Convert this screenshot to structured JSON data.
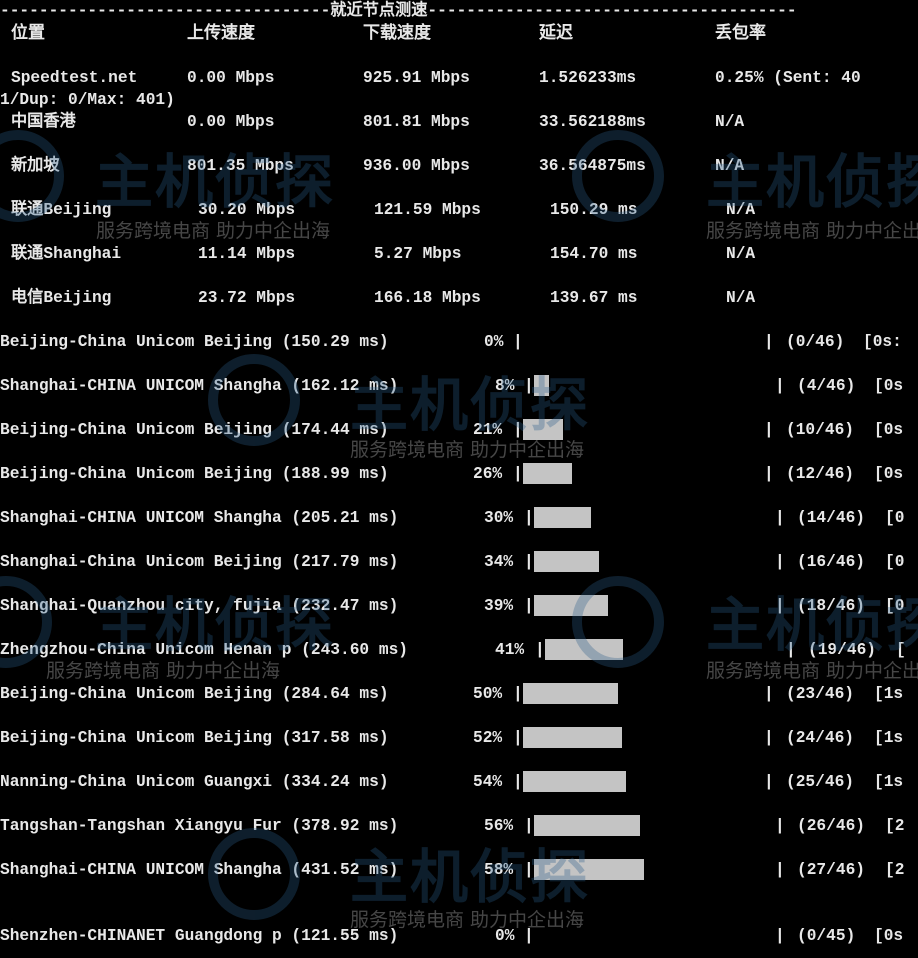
{
  "header": {
    "title": "就近节点测速",
    "dashes_left": "-------------------------------",
    "dashes_right": "-------------------------------"
  },
  "columns": {
    "node": "位置",
    "upload": "上传速度",
    "download": "下载速度",
    "latency": "延迟",
    "loss": "丢包率"
  },
  "speedtest_rows": [
    {
      "node": "Speedtest.net",
      "upload": "0.00 Mbps",
      "download": "925.91 Mbps",
      "latency": "1.526233ms",
      "loss": "0.25% (Sent: 40",
      "wrap": "1/Dup: 0/Max: 401)"
    },
    {
      "node": "中国香港",
      "upload": "0.00 Mbps",
      "download": "801.81 Mbps",
      "latency": "33.562188ms",
      "loss": "N/A"
    },
    {
      "node": "新加坡",
      "upload": "801.35 Mbps",
      "download": "936.00 Mbps",
      "latency": "36.564875ms",
      "loss": "N/A"
    },
    {
      "node": "联通Beijing",
      "upload": "30.20 Mbps",
      "download": "121.59 Mbps",
      "latency": "150.29 ms",
      "loss": "N/A"
    },
    {
      "node": "联通Shanghai",
      "upload": "11.14 Mbps",
      "download": "5.27 Mbps",
      "latency": "154.70 ms",
      "loss": "N/A"
    },
    {
      "node": "电信Beijing",
      "upload": "23.72 Mbps",
      "download": "166.18 Mbps",
      "latency": "139.67 ms",
      "loss": "N/A"
    }
  ],
  "route_rows": [
    {
      "label": "Beijing-China Unicom Beijing (150.29 ms)",
      "percent": "0%",
      "progress": 0.0,
      "count": "(0/46)",
      "tail": "[0s:"
    },
    {
      "label": "Shanghai-CHINA UNICOM Shangha (162.12 ms)",
      "percent": "8%",
      "progress": 0.08,
      "count": "(4/46)",
      "tail": "[0s"
    },
    {
      "label": "Beijing-China Unicom Beijing (174.44 ms)",
      "percent": "21%",
      "progress": 0.21,
      "count": "(10/46)",
      "tail": "[0s"
    },
    {
      "label": "Beijing-China Unicom Beijing (188.99 ms)",
      "percent": "26%",
      "progress": 0.26,
      "count": "(12/46)",
      "tail": "[0s"
    },
    {
      "label": "Shanghai-CHINA UNICOM Shangha (205.21 ms)",
      "percent": "30%",
      "progress": 0.3,
      "count": "(14/46)",
      "tail": "[0"
    },
    {
      "label": "Shanghai-China Unicom Beijing (217.79 ms)",
      "percent": "34%",
      "progress": 0.34,
      "count": "(16/46)",
      "tail": "[0"
    },
    {
      "label": "Shanghai-Quanzhou city, fujia (232.47 ms)",
      "percent": "39%",
      "progress": 0.39,
      "count": "(18/46)",
      "tail": "[0"
    },
    {
      "label": "Zhengzhou-China Unicom Henan p (243.60 ms)",
      "percent": "41%",
      "progress": 0.41,
      "count": "(19/46)",
      "tail": "["
    },
    {
      "label": "Beijing-China Unicom Beijing (284.64 ms)",
      "percent": "50%",
      "progress": 0.5,
      "count": "(23/46)",
      "tail": "[1s"
    },
    {
      "label": "Beijing-China Unicom Beijing (317.58 ms)",
      "percent": "52%",
      "progress": 0.52,
      "count": "(24/46)",
      "tail": "[1s"
    },
    {
      "label": "Nanning-China Unicom Guangxi (334.24 ms)",
      "percent": "54%",
      "progress": 0.54,
      "count": "(25/46)",
      "tail": "[1s"
    },
    {
      "label": "Tangshan-Tangshan Xiangyu Fur (378.92 ms)",
      "percent": "56%",
      "progress": 0.56,
      "count": "(26/46)",
      "tail": "[2"
    },
    {
      "label": "Shanghai-CHINA UNICOM Shangha (431.52 ms)",
      "percent": "58%",
      "progress": 0.58,
      "count": "(27/46)",
      "tail": "[2"
    },
    {
      "label": "Shenzhen-CHINANET Guangdong p (121.55 ms)",
      "percent": "0%",
      "progress": 0.0,
      "count": "(0/45)",
      "tail": "[0s"
    }
  ],
  "watermark": {
    "logo": "主机侦探",
    "slogan": "服务跨境电商 助力中企出海"
  },
  "colors": {
    "background": "#000000",
    "text": "#e8e8e8",
    "progress_fill": "#c4c4c4",
    "watermark_blue": "#2a5e8a"
  }
}
